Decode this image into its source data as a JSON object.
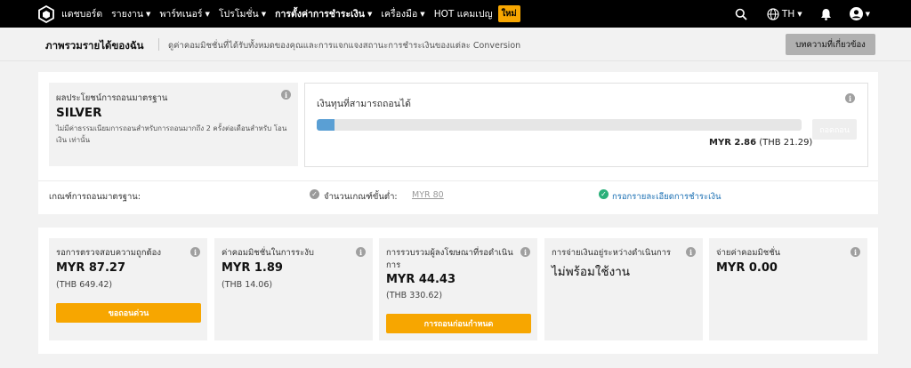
{
  "nav": {
    "home": "แดชบอร์ด",
    "items": [
      {
        "label": "รายงาน"
      },
      {
        "label": "พาร์ทเนอร์"
      },
      {
        "label": "โปรโมชั่น"
      },
      {
        "label": "การตั้งค่าการชำระเงิน"
      },
      {
        "label": "เครื่องมือ"
      }
    ],
    "hot": "HOT แคมเปญ",
    "new_badge": "ใหม่",
    "language": "TH"
  },
  "header": {
    "title": "ภาพรวมรายได้ของฉัน",
    "description": "ดูค่าคอมมิชชั่นที่ได้รับทั้งหมดของคุณและการแจกแจงสถานะการชำระเงินของแต่ละ Conversion",
    "article_button": "บทความที่เกี่ยวข้อง"
  },
  "withdrawal": {
    "tier_label": "ผลประโยชน์การถอนมาตรฐาน",
    "tier_name": "SILVER",
    "tier_desc": "ไม่มีค่าธรรมเนียมการถอนสำหรับการถอนมากถึง 2 ครั้งต่อเดือนสำหรับ โอนเงิน เท่านั้น",
    "funds_label": "เงินทุนที่สามารถถอนได้",
    "withdraw_button": "ถอดถอน",
    "progress_fraction": 0.036,
    "amount_myr": "MYR 2.86",
    "amount_thb": "(THB 21.29)"
  },
  "criteria": {
    "label": "เกณฑ์การถอนมาตรฐาน:",
    "min_label": "จำนวนเกณฑ์ขั้นต่ำ:",
    "min_value": "MYR 80",
    "payment_link": "กรอกรายละเอียดการชำระเงิน"
  },
  "cards": [
    {
      "title": "รอการตรวจสอบความถูกต้อง",
      "amount": "MYR 87.27",
      "sub": "(THB 649.42)",
      "button": "ขอถอนด่วน"
    },
    {
      "title": "ค่าคอมมิชชั่นในการระงับ",
      "amount": "MYR 1.89",
      "sub": "(THB 14.06)"
    },
    {
      "title": "การรวบรวมผู้ลงโฆษณาที่รอดำเนินการ",
      "amount": "MYR 44.43",
      "sub": "(THB 330.62)",
      "button": "การถอนก่อนกำหนด"
    },
    {
      "title": "การจ่ายเงินอยู่ระหว่างดำเนินการ",
      "status": "ไม่พร้อมใช้งาน"
    },
    {
      "title": "จ่ายค่าคอมมิชชั่น",
      "amount": "MYR 0.00"
    }
  ],
  "colors": {
    "accent": "#f7a600",
    "progress": "#5a9fd4",
    "link": "#1a6fb3",
    "success": "#2bb07a"
  }
}
